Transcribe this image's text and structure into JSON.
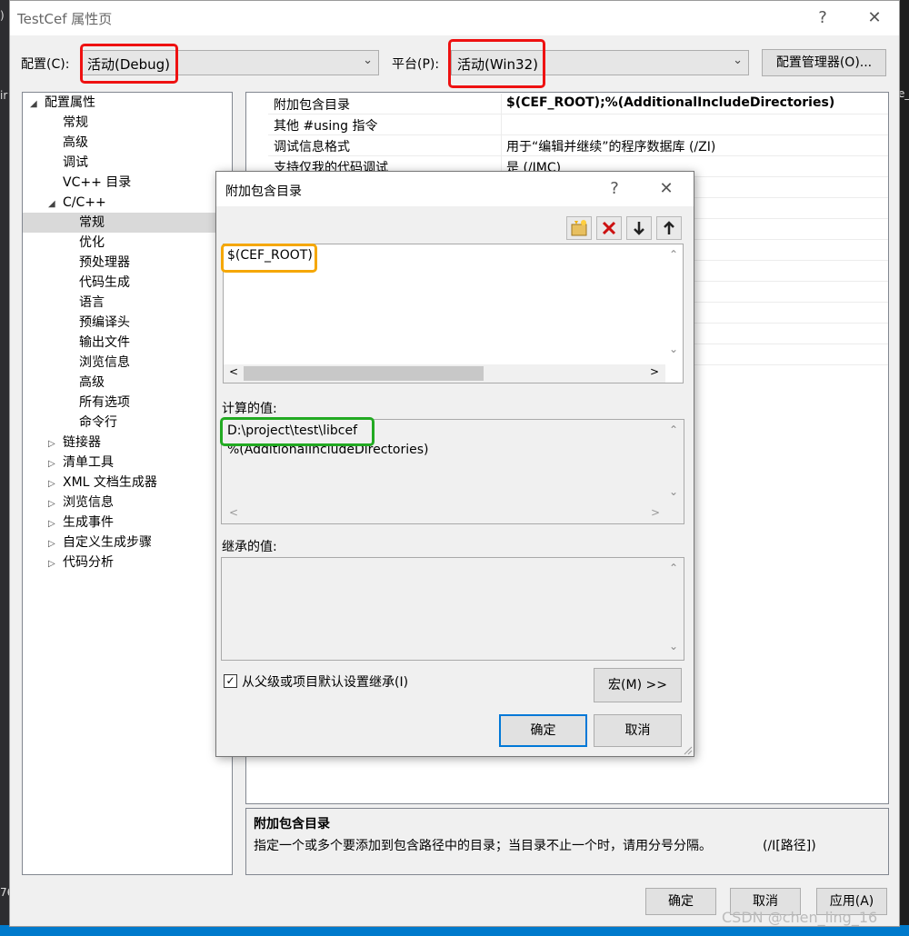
{
  "background": {
    "left_frag": ")",
    "left_frag2": "ir",
    "left_frag3": "76",
    "right_frag": "e_"
  },
  "window": {
    "title": "TestCef 属性页",
    "help": "?",
    "close": "✕",
    "config_label": "配置(C):",
    "config_value": "活动(Debug)",
    "platform_label": "平台(P):",
    "platform_value": "活动(Win32)",
    "config_manager": "配置管理器(O)...",
    "ok": "确定",
    "cancel": "取消",
    "apply": "应用(A)"
  },
  "tree": {
    "root": "配置属性",
    "items_l1": [
      "常规",
      "高级",
      "调试",
      "VC++ 目录"
    ],
    "cpp": "C/C++",
    "cpp_children": [
      "常规",
      "优化",
      "预处理器",
      "代码生成",
      "语言",
      "预编译头",
      "输出文件",
      "浏览信息",
      "高级",
      "所有选项",
      "命令行"
    ],
    "collapsed": [
      "链接器",
      "清单工具",
      "XML 文档生成器",
      "浏览信息",
      "生成事件",
      "自定义生成步骤",
      "代码分析"
    ]
  },
  "grid": {
    "rows": [
      {
        "name": "附加包含目录",
        "value": "$(CEF_ROOT);%(AdditionalIncludeDirectories)"
      },
      {
        "name": "其他 #using 指令",
        "value": ""
      },
      {
        "name": "调试信息格式",
        "value": "用于“编辑并继续”的程序数据库 (/ZI)"
      },
      {
        "name": "支持仅我的代码调试",
        "value": "是 (/JMC)"
      }
    ]
  },
  "description": {
    "title": "附加包含目录",
    "text": "指定一个或多个要添加到包含路径中的目录；当目录不止一个时，请用分号分隔。",
    "switch": "(/I[路径])"
  },
  "dialog": {
    "title": "附加包含目录",
    "help": "?",
    "close": "✕",
    "entry": "$(CEF_ROOT)",
    "computed_label": "计算的值:",
    "computed_lines": [
      "D:\\project\\test\\libcef",
      "%(AdditionalIncludeDirectories)"
    ],
    "inherited_label": "继承的值:",
    "inherit_checkbox": "从父级或项目默认设置继承(I)",
    "inherit_checked": true,
    "macros": "宏(M) >>",
    "ok": "确定",
    "cancel": "取消"
  },
  "watermark": "CSDN @chen_ling_16",
  "colors": {
    "highlight_red": "#e11111",
    "highlight_orange": "#f5a700",
    "highlight_green": "#22aa22",
    "focus_blue": "#0078d7"
  }
}
